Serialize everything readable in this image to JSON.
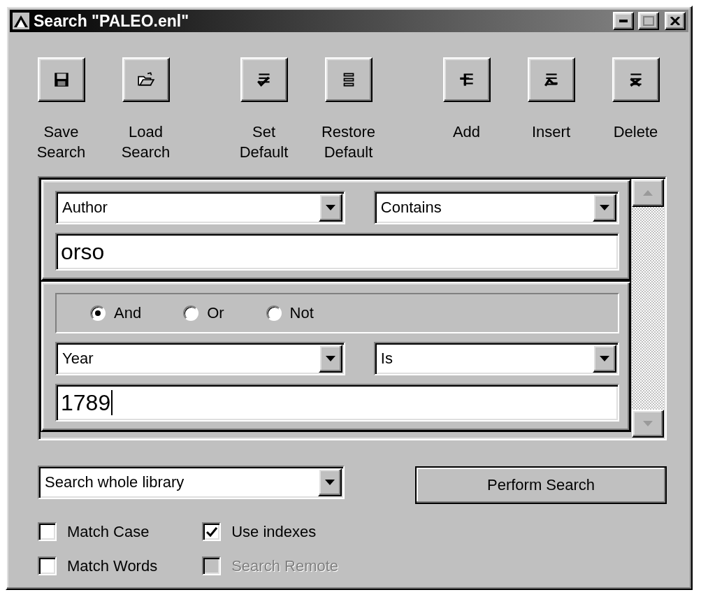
{
  "window": {
    "title": "Search \"PALEO.enl\""
  },
  "toolbar": [
    [
      {
        "lines": [
          "Save",
          "Search"
        ]
      },
      {
        "lines": [
          "Load",
          "Search"
        ]
      }
    ],
    [
      {
        "lines": [
          "Set",
          "Default"
        ]
      },
      {
        "lines": [
          "Restore",
          "Default"
        ]
      }
    ],
    [
      {
        "lines": [
          "Add"
        ]
      },
      {
        "lines": [
          "Insert"
        ]
      },
      {
        "lines": [
          "Delete"
        ]
      }
    ]
  ],
  "criteria": [
    {
      "field": "Author",
      "operator": "Contains",
      "value": "orso",
      "focused": false
    },
    {
      "connectors": [
        {
          "label": "And",
          "selected": true
        },
        {
          "label": "Or",
          "selected": false
        },
        {
          "label": "Not",
          "selected": false
        }
      ],
      "field": "Year",
      "operator": "Is",
      "value": "1789",
      "focused": true
    }
  ],
  "scope": "Search whole library",
  "perform_button": "Perform Search",
  "options": [
    [
      {
        "label": "Match Case",
        "checked": false,
        "disabled": false
      },
      {
        "label": "Match Words",
        "checked": false,
        "disabled": false
      }
    ],
    [
      {
        "label": "Use indexes",
        "checked": true,
        "disabled": false
      },
      {
        "label": "Search Remote",
        "checked": false,
        "disabled": true
      }
    ]
  ]
}
